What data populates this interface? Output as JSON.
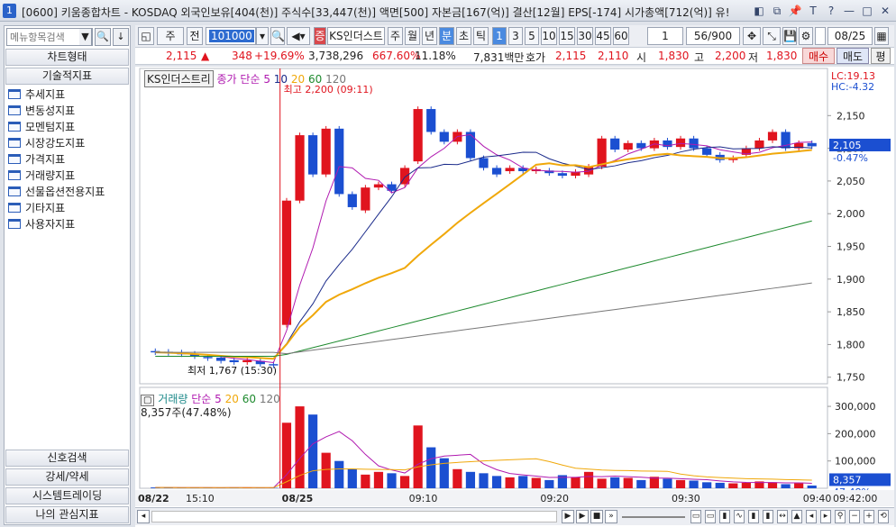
{
  "window": {
    "number": "1",
    "title": "[0600] 키움종합차트 - KOSDAQ 외국인보유[404(천)] 주식수[33,447(천)] 액면[500] 자본금[167(억)] 결산[12월] EPS[-174] 시가총액[712(억)] 유!",
    "controls": [
      "◧",
      "⧉",
      "📌",
      "T",
      "?",
      "—",
      "□",
      "✕"
    ]
  },
  "sidebar": {
    "search_placeholder": "메뉴항목검색",
    "search_btn": "▼",
    "find_btn": "🔍",
    "down_btn": "↓",
    "header_chart_type": "차트형태",
    "header_technical": "기술적지표",
    "items": [
      "추세지표",
      "변동성지표",
      "모멘텀지표",
      "시장강도지표",
      "가격지표",
      "거래량지표",
      "선물옵션전용지표",
      "기타지표",
      "사용자지표"
    ],
    "bottom": [
      "신호검색",
      "강세/약세",
      "시스템트레이딩",
      "나의 관심지표"
    ]
  },
  "toolbar": {
    "type_select": "주",
    "prev_btn": "전",
    "code": "101000",
    "stock_name": "KS인더스트",
    "period_tabs": [
      "주",
      "월",
      "년",
      "분",
      "초",
      "틱"
    ],
    "active_period": "분",
    "intervals": [
      "1",
      "3",
      "5",
      "10",
      "15",
      "30",
      "45",
      "60"
    ],
    "active_interval": "1",
    "count_select": "1",
    "bars": "56/900",
    "date": "08/25"
  },
  "quote": {
    "price": "2,115",
    "arrow": "▲",
    "change": "348",
    "change_pct": "+19.69%",
    "volume": "3,738,296",
    "vol_pct": "667.60%",
    "turnover": "11.18%",
    "amount": "7,831백만",
    "hoga_label": "호가",
    "ask": "2,115",
    "bid": "2,110",
    "open_label": "시",
    "open": "1,830",
    "high_label": "고",
    "high": "2,200",
    "low_label": "저",
    "low": "1,830",
    "buy": "매수",
    "sell": "매도",
    "pyeong": "평"
  },
  "chart_legend": {
    "name": "KS인더스트리",
    "price_ma": "종가 단순",
    "ma_periods": [
      "5",
      "10",
      "20",
      "60",
      "120"
    ],
    "high_note": "최고 2,200 (09:11)",
    "low_note": "최저 1,767 (15:30)",
    "lc": "LC:19.13",
    "hc": "HC:-4.32",
    "current_price": "2,105",
    "current_pct": "-0.47%",
    "volume_title": "거래량",
    "vol_ma": "단순",
    "vol_periods": [
      "5",
      "20",
      "60",
      "120"
    ],
    "vol_readout": "8,357주(47.48%)",
    "vol_current": "8,357",
    "vol_pct": "47.48%"
  },
  "axis": {
    "price_ticks": [
      "2,150",
      "2,100",
      "2,050",
      "2,000",
      "1,950",
      "1,900",
      "1,850",
      "1,800",
      "1,750"
    ],
    "volume_ticks": [
      "300,000",
      "200,000",
      "100,000"
    ],
    "time_labels": [
      "08/22",
      "15:10",
      "08/25",
      "09:10",
      "09:20",
      "09:30",
      "09:40",
      "09:42:00"
    ]
  },
  "colors": {
    "up": "#e0141e",
    "down": "#1b4fd1",
    "ma5": "#b01ab0",
    "ma10": "#1a2a8a",
    "ma20": "#f0a80a",
    "ma60": "#1e8a2e",
    "ma120": "#777777"
  },
  "chart_data": {
    "type": "line",
    "candles": [
      {
        "t": "a",
        "o": 1790,
        "c": 1788
      },
      {
        "t": "b",
        "o": 1789,
        "c": 1787
      },
      {
        "t": "c",
        "o": 1788,
        "c": 1785
      },
      {
        "t": "d",
        "o": 1786,
        "c": 1782
      },
      {
        "t": "e",
        "o": 1781,
        "c": 1779
      },
      {
        "t": "f",
        "o": 1780,
        "c": 1775
      },
      {
        "t": "g",
        "o": 1776,
        "c": 1773
      },
      {
        "t": "h",
        "o": 1773,
        "c": 1776
      },
      {
        "t": "i",
        "o": 1775,
        "c": 1770
      },
      {
        "t": "j",
        "o": 1770,
        "c": 1768
      },
      {
        "t": "09:00",
        "o": 1830,
        "c": 2020
      },
      {
        "t": "09:01",
        "o": 2020,
        "c": 2120
      },
      {
        "t": "09:02",
        "o": 2120,
        "c": 2060
      },
      {
        "t": "09:03",
        "o": 2060,
        "c": 2130
      },
      {
        "t": "09:04",
        "o": 2130,
        "c": 2030
      },
      {
        "t": "09:05",
        "o": 2030,
        "c": 2010
      },
      {
        "t": "09:06",
        "o": 2005,
        "c": 2040
      },
      {
        "t": "09:07",
        "o": 2040,
        "c": 2045
      },
      {
        "t": "09:08",
        "o": 2045,
        "c": 2035
      },
      {
        "t": "09:09",
        "o": 2045,
        "c": 2070
      },
      {
        "t": "09:10",
        "o": 2080,
        "c": 2160
      },
      {
        "t": "09:11",
        "o": 2160,
        "c": 2125
      },
      {
        "t": "09:12",
        "o": 2125,
        "c": 2110
      },
      {
        "t": "09:13",
        "o": 2110,
        "c": 2125
      },
      {
        "t": "09:14",
        "o": 2125,
        "c": 2085
      },
      {
        "t": "09:15",
        "o": 2085,
        "c": 2070
      },
      {
        "t": "09:16",
        "o": 2070,
        "c": 2060
      },
      {
        "t": "09:17",
        "o": 2065,
        "c": 2070
      },
      {
        "t": "09:18",
        "o": 2070,
        "c": 2065
      },
      {
        "t": "09:19",
        "o": 2065,
        "c": 2068
      },
      {
        "t": "09:20",
        "o": 2066,
        "c": 2062
      },
      {
        "t": "09:21",
        "o": 2062,
        "c": 2058
      },
      {
        "t": "09:22",
        "o": 2058,
        "c": 2064
      },
      {
        "t": "09:23",
        "o": 2060,
        "c": 2072
      },
      {
        "t": "09:24",
        "o": 2072,
        "c": 2115
      },
      {
        "t": "09:25",
        "o": 2115,
        "c": 2098
      },
      {
        "t": "09:26",
        "o": 2098,
        "c": 2108
      },
      {
        "t": "09:27",
        "o": 2108,
        "c": 2100
      },
      {
        "t": "09:28",
        "o": 2100,
        "c": 2112
      },
      {
        "t": "09:29",
        "o": 2112,
        "c": 2102
      },
      {
        "t": "09:30",
        "o": 2102,
        "c": 2115
      },
      {
        "t": "09:31",
        "o": 2115,
        "c": 2100
      },
      {
        "t": "09:32",
        "o": 2100,
        "c": 2090
      },
      {
        "t": "09:33",
        "o": 2090,
        "c": 2082
      },
      {
        "t": "09:34",
        "o": 2082,
        "c": 2085
      },
      {
        "t": "09:35",
        "o": 2090,
        "c": 2100
      },
      {
        "t": "09:36",
        "o": 2100,
        "c": 2112
      },
      {
        "t": "09:37",
        "o": 2112,
        "c": 2125
      },
      {
        "t": "09:38",
        "o": 2125,
        "c": 2100
      },
      {
        "t": "09:39",
        "o": 2100,
        "c": 2108
      },
      {
        "t": "09:40",
        "o": 2108,
        "c": 2103
      }
    ],
    "volumes": [
      3000,
      2500,
      2000,
      2800,
      2200,
      1800,
      2600,
      2400,
      2000,
      1500,
      240000,
      300000,
      270000,
      130000,
      100000,
      70000,
      50000,
      60000,
      55000,
      45000,
      230000,
      150000,
      110000,
      70000,
      60000,
      55000,
      45000,
      40000,
      45000,
      38000,
      30000,
      48000,
      40000,
      60000,
      35000,
      40000,
      38000,
      30000,
      42000,
      35000,
      30000,
      28000,
      22000,
      20000,
      18000,
      20000,
      25000,
      22000,
      15000,
      18000,
      10000
    ],
    "ylim": [
      1740,
      2200
    ],
    "vol_ylim": [
      0,
      330000
    ]
  }
}
